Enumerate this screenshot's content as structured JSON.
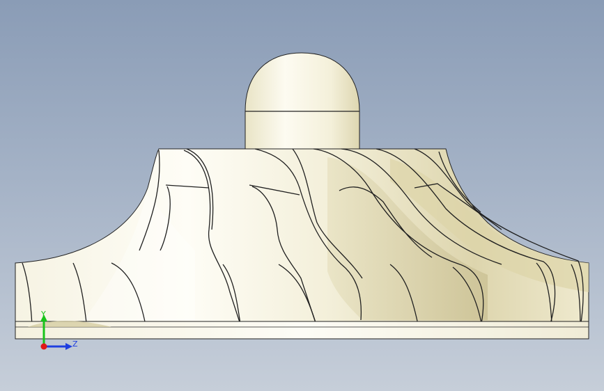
{
  "viewport": {
    "background_top": "#8a9cb6",
    "background_bottom": "#c6ced9",
    "model": "impeller-with-dome-nose",
    "view_orientation": "front"
  },
  "model_colors": {
    "surface_light": "#fbf8ec",
    "surface_mid": "#eae5c8",
    "surface_shadow": "#cfc69c",
    "edge": "#222222"
  },
  "triad": {
    "y_label": "Y",
    "z_label": "Z",
    "y_color": "#19c41b",
    "z_color": "#1f3fe0",
    "x_color": "#e01818"
  }
}
